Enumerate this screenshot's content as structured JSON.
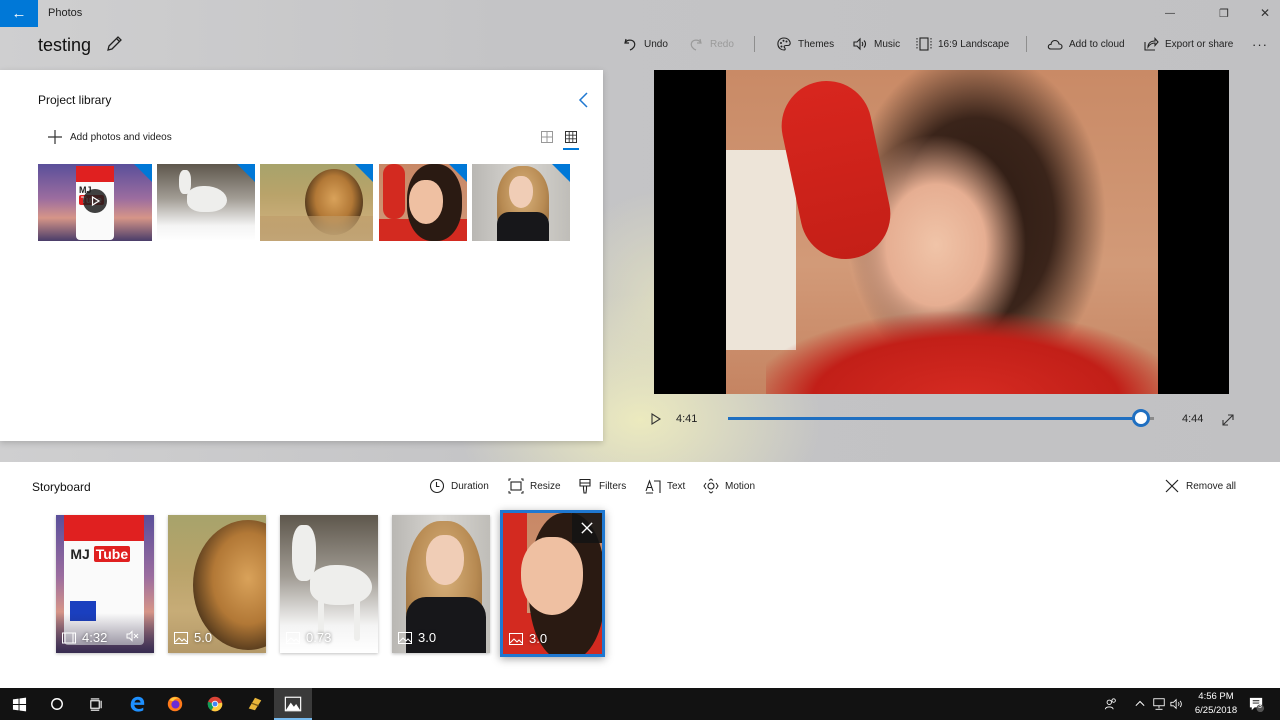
{
  "window": {
    "app_name": "Photos",
    "back_label": "←",
    "minimize_label": "—",
    "restore_label": "❐",
    "close_label": "✕"
  },
  "header": {
    "project_title": "testing",
    "toolbar": {
      "undo": "Undo",
      "redo": "Redo",
      "themes": "Themes",
      "music": "Music",
      "aspect_ratio": "16:9 Landscape",
      "add_to_cloud": "Add to cloud",
      "export_or_share": "Export or share",
      "more": "···"
    }
  },
  "library": {
    "title": "Project library",
    "add_label": "Add photos and videos",
    "view_mode_selected": "grid-small",
    "items": [
      {
        "name": "video-mjtube",
        "type": "video"
      },
      {
        "name": "white-horse",
        "type": "photo"
      },
      {
        "name": "lion",
        "type": "photo"
      },
      {
        "name": "girl-red-shirt",
        "type": "photo"
      },
      {
        "name": "blonde-woman",
        "type": "photo"
      }
    ]
  },
  "preview": {
    "current_time": "4:41",
    "total_time": "4:44",
    "progress_percent": 97
  },
  "storyboard": {
    "title": "Storyboard",
    "tools": {
      "duration": "Duration",
      "resize": "Resize",
      "filters": "Filters",
      "text": "Text",
      "motion": "Motion"
    },
    "remove_all": "Remove all",
    "cards": [
      {
        "type": "video",
        "duration": "4:32",
        "muted": true
      },
      {
        "type": "photo",
        "duration": "5.0"
      },
      {
        "type": "photo",
        "duration": "0.73"
      },
      {
        "type": "photo",
        "duration": "3.0"
      },
      {
        "type": "photo",
        "duration": "3.0",
        "selected": true
      }
    ]
  },
  "taskbar": {
    "time": "4:56 PM",
    "date": "6/25/2018",
    "notification_count": "3"
  },
  "colors": {
    "accent": "#0078d7",
    "progress": "#1f6fc1"
  }
}
